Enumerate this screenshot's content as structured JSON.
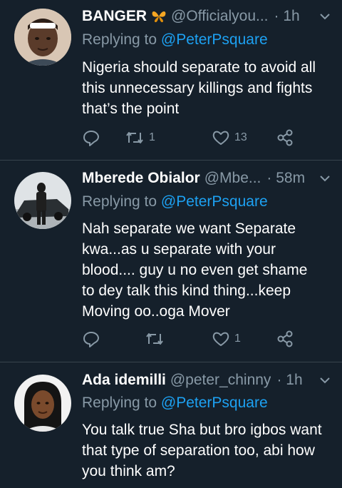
{
  "tweets": [
    {
      "name": "BANGER",
      "badge": "butterfly",
      "handle": "@Officialyou...",
      "time": "· 1h",
      "reply_prefix": "Replying to",
      "reply_to": "@PeterPsquare",
      "lines": [
        "Nigeria should separate to avoid all",
        "this unnecessary killings and fights",
        "that’s the point"
      ],
      "counts": {
        "retweets": "1",
        "likes": "13"
      }
    },
    {
      "name": "Mberede Obialor",
      "handle": "@Mbe...",
      "time": "· 58m",
      "reply_prefix": "Replying to",
      "reply_to": "@PeterPsquare",
      "lines": [
        "Nah separate we want Separate",
        "kwa...as u separate with your",
        "blood.... guy u no even get shame",
        "to dey talk this kind thing...keep",
        "Moving oo..oga Mover"
      ],
      "counts": {
        "retweets": "",
        "likes": "1"
      }
    },
    {
      "name": "Ada idemilli",
      "handle": "@peter_chinny",
      "time": "· 1h",
      "reply_prefix": "Replying to",
      "reply_to": "@PeterPsquare",
      "lines": [
        "You talk true Sha but bro igbos want",
        "that type of separation too, abi how",
        "you think am?"
      ]
    }
  ],
  "icons": {
    "reply": "reply-icon",
    "retweet": "retweet-icon",
    "like": "heart-icon",
    "share": "share-icon",
    "more": "chevron-down-icon"
  },
  "colors": {
    "background": "#15202b",
    "secondary_text": "#8899a6",
    "link": "#1da1f2",
    "divider": "#38444d"
  }
}
